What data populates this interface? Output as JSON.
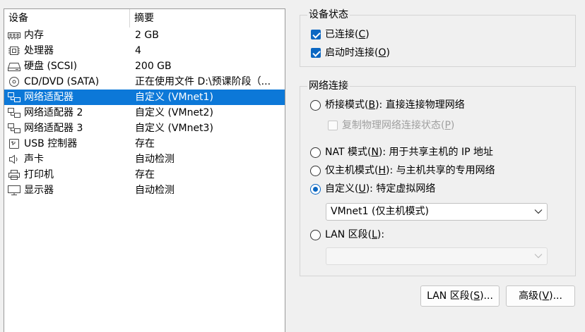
{
  "device_list": {
    "col_device": "设备",
    "col_summary": "摘要",
    "rows": [
      {
        "icon": "memory-icon",
        "name": "内存",
        "summary": "2 GB"
      },
      {
        "icon": "cpu-icon",
        "name": "处理器",
        "summary": "4"
      },
      {
        "icon": "hard-disk-icon",
        "name": "硬盘 (SCSI)",
        "summary": "200 GB"
      },
      {
        "icon": "cd-dvd-icon",
        "name": "CD/DVD (SATA)",
        "summary": "正在使用文件 D:\\预课阶段（..."
      },
      {
        "icon": "network-adapter-icon",
        "name": "网络适配器",
        "summary": "自定义 (VMnet1)",
        "selected": true
      },
      {
        "icon": "network-adapter-icon",
        "name": "网络适配器 2",
        "summary": "自定义 (VMnet2)"
      },
      {
        "icon": "network-adapter-icon",
        "name": "网络适配器 3",
        "summary": "自定义 (VMnet3)"
      },
      {
        "icon": "usb-icon",
        "name": "USB 控制器",
        "summary": "存在"
      },
      {
        "icon": "speaker-icon",
        "name": "声卡",
        "summary": "自动检测"
      },
      {
        "icon": "printer-icon",
        "name": "打印机",
        "summary": "存在"
      },
      {
        "icon": "monitor-icon",
        "name": "显示器",
        "summary": "自动检测"
      }
    ]
  },
  "device_status": {
    "title": "设备状态",
    "connected": {
      "text": "已连接(",
      "key": "C",
      "end": ")",
      "checked": true
    },
    "connect_at_power_on": {
      "text": "启动时连接(",
      "key": "O",
      "end": ")",
      "checked": true
    }
  },
  "network_connection": {
    "title": "网络连接",
    "bridged": {
      "text": "桥接模式(",
      "key": "B",
      "end": "): 直接连接物理网络",
      "selected": false
    },
    "replicate": {
      "text": "复制物理网络连接状态(",
      "key": "P",
      "end": ")",
      "checked": false
    },
    "nat": {
      "text": "NAT 模式(",
      "key": "N",
      "end": "): 用于共享主机的 IP 地址",
      "selected": false
    },
    "host_only": {
      "text": "仅主机模式(",
      "key": "H",
      "end": "): 与主机共享的专用网络",
      "selected": false
    },
    "custom": {
      "text": "自定义(",
      "key": "U",
      "end": "): 特定虚拟网络",
      "selected": true
    },
    "custom_select_value": "VMnet1 (仅主机模式)",
    "lan_segment": {
      "text": "LAN 区段(",
      "key": "L",
      "end": "):",
      "selected": false
    },
    "lan_select_value": ""
  },
  "buttons": {
    "lan_segments": {
      "text": "LAN 区段(",
      "key": "S",
      "end": ")..."
    },
    "advanced": {
      "text": "高级(",
      "key": "V",
      "end": ")..."
    }
  },
  "colors": {
    "selection": "#0c78d8",
    "accent": "#0b67c2"
  }
}
